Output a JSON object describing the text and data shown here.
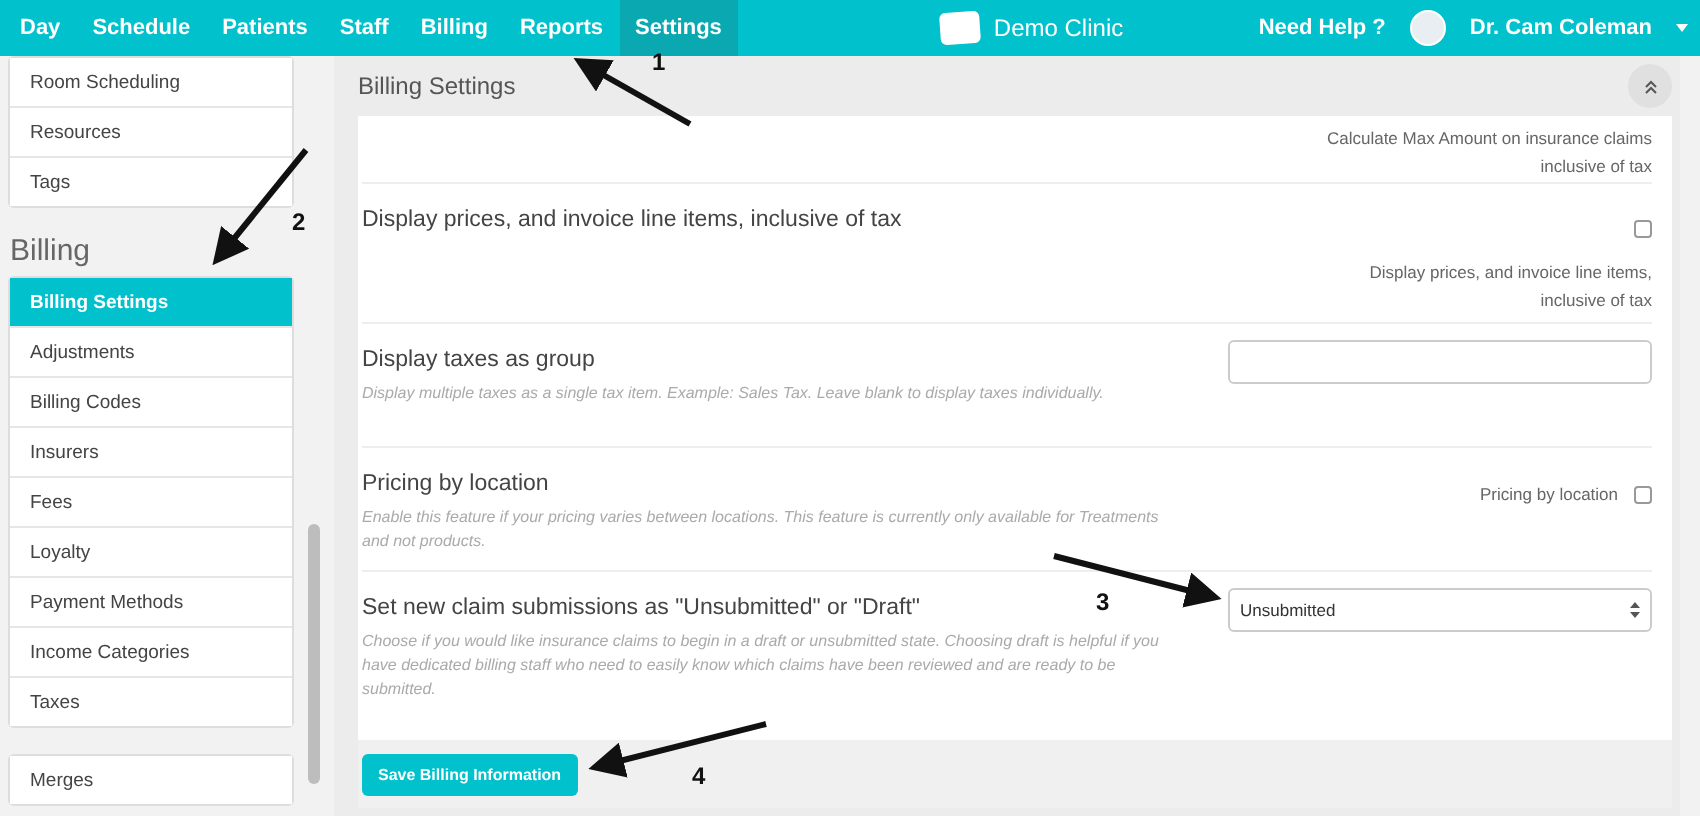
{
  "nav": {
    "items": [
      {
        "label": "Day",
        "selected": false
      },
      {
        "label": "Schedule",
        "selected": false
      },
      {
        "label": "Patients",
        "selected": false
      },
      {
        "label": "Staff",
        "selected": false
      },
      {
        "label": "Billing",
        "selected": false
      },
      {
        "label": "Reports",
        "selected": false
      },
      {
        "label": "Settings",
        "selected": true
      }
    ],
    "brand": "Demo Clinic",
    "help": "Need Help ?",
    "user": "Dr. Cam Coleman"
  },
  "sidebar": {
    "top_items": [
      {
        "label": "Room Scheduling",
        "selected": false
      },
      {
        "label": "Resources",
        "selected": false
      },
      {
        "label": "Tags",
        "selected": false
      }
    ],
    "section_title": "Billing",
    "billing_items": [
      {
        "label": "Billing Settings",
        "selected": true
      },
      {
        "label": "Adjustments",
        "selected": false
      },
      {
        "label": "Billing Codes",
        "selected": false
      },
      {
        "label": "Insurers",
        "selected": false
      },
      {
        "label": "Fees",
        "selected": false
      },
      {
        "label": "Loyalty",
        "selected": false
      },
      {
        "label": "Payment Methods",
        "selected": false
      },
      {
        "label": "Income Categories",
        "selected": false
      },
      {
        "label": "Taxes",
        "selected": false
      }
    ],
    "bottom_items": [
      {
        "label": "Merges",
        "selected": false
      }
    ]
  },
  "panel": {
    "title": "Billing Settings",
    "rows": [
      {
        "kind": "note",
        "note": "Calculate Max Amount on insurance claims inclusive of tax"
      },
      {
        "kind": "checkbox_below",
        "title": "Display prices, and invoice line items, inclusive of tax",
        "checked": false,
        "label": "Display prices, and invoice line items, inclusive of tax"
      },
      {
        "kind": "text",
        "title": "Display taxes as group",
        "description": "Display multiple taxes as a single tax item. Example: Sales Tax. Leave blank to display taxes individually."
      },
      {
        "kind": "checkbox_inline",
        "title": "Pricing by location",
        "description": "Enable this feature if your pricing varies between locations. This feature is currently only available for Treatments and not products.",
        "checked": false,
        "label": "Pricing by location"
      },
      {
        "kind": "select",
        "title": "Set new claim submissions as \"Unsubmitted\" or \"Draft\"",
        "description": "Choose if you would like insurance claims to begin in a draft or unsubmitted state. Choosing draft is helpful if you have dedicated billing staff who need to easily know which claims have been reviewed and are ready to be submitted.",
        "value": "Unsubmitted"
      }
    ],
    "save_button": "Save Billing Information"
  },
  "annotations": [
    {
      "number": "1"
    },
    {
      "number": "2"
    },
    {
      "number": "3"
    },
    {
      "number": "4"
    }
  ]
}
